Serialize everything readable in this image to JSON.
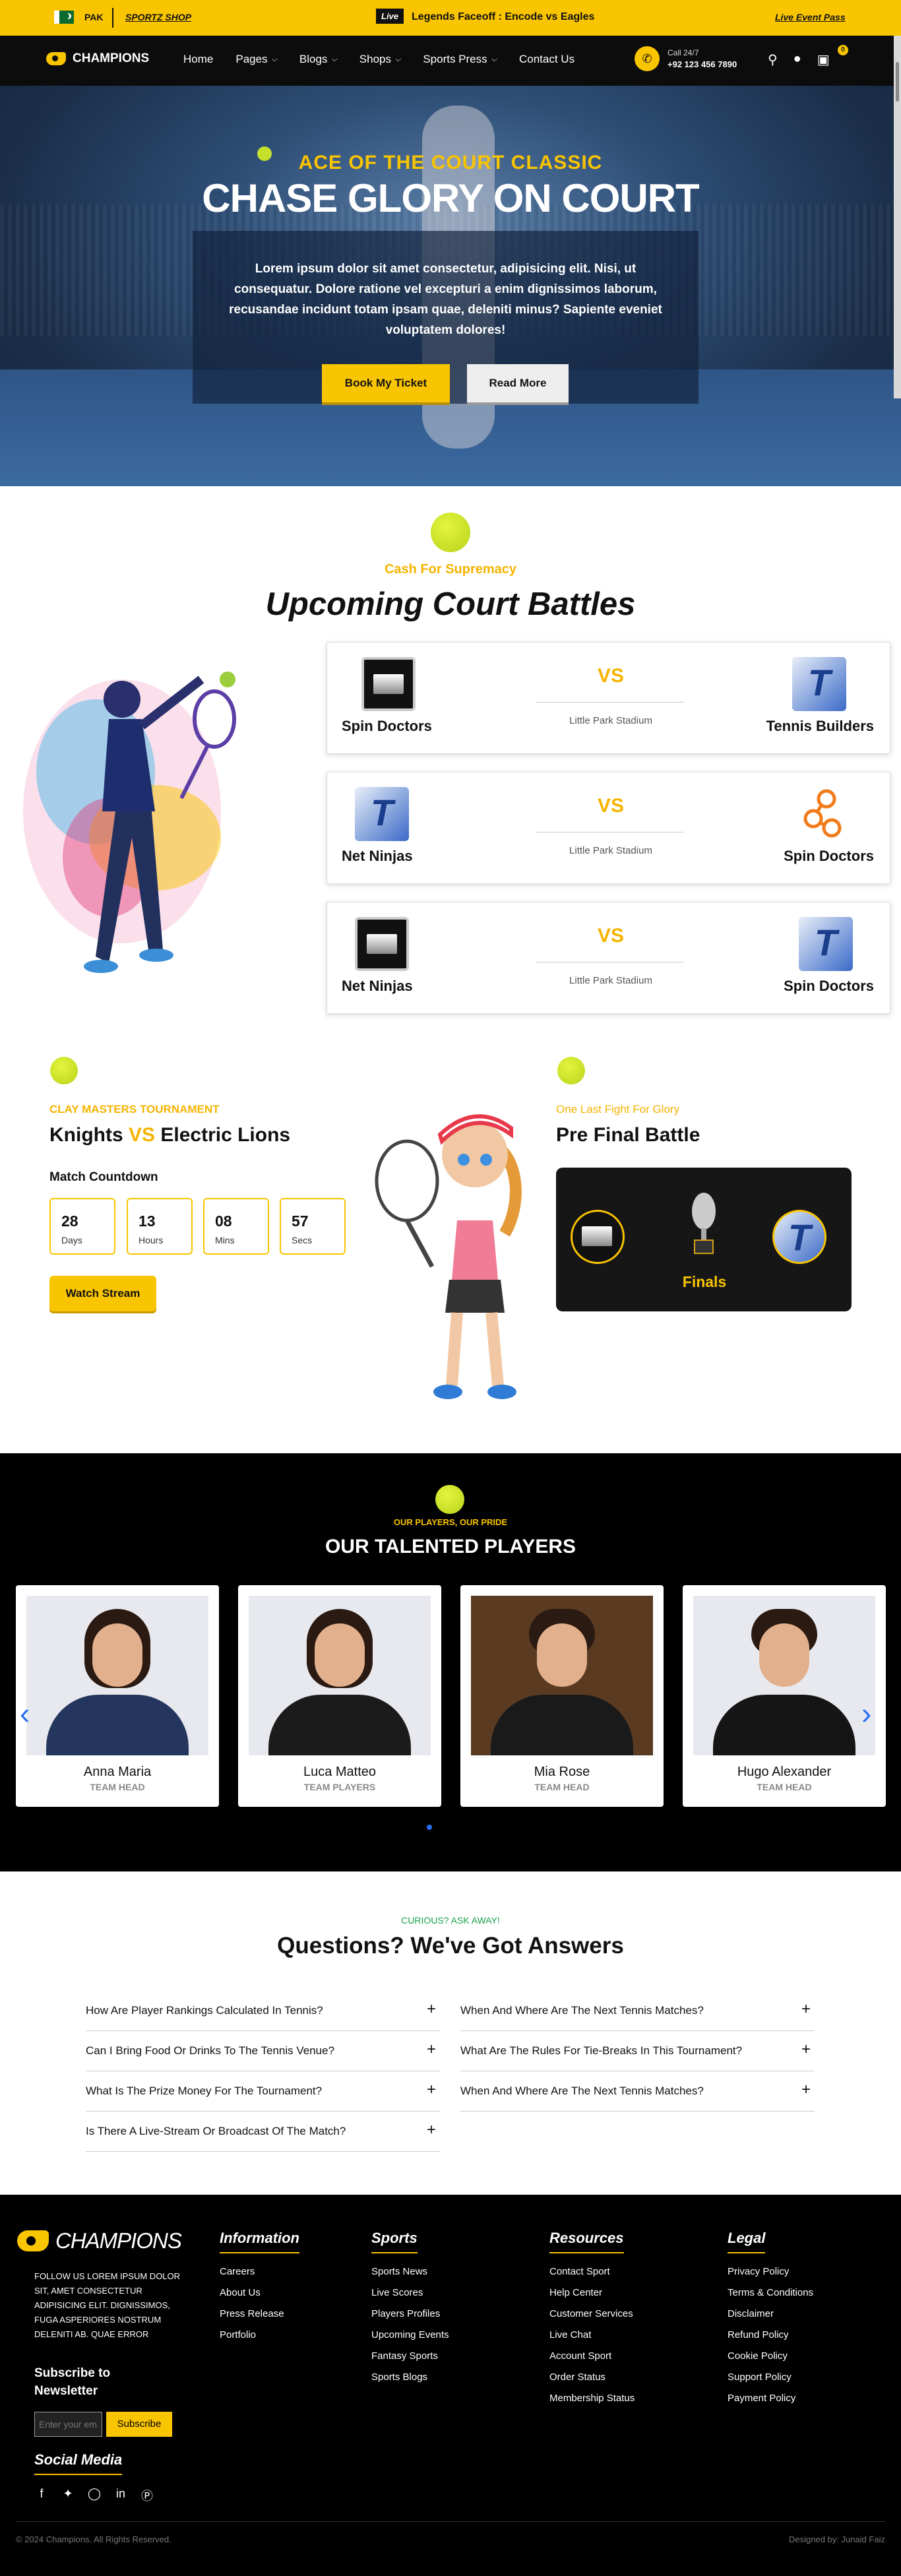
{
  "topbar": {
    "country": "PAK",
    "brand": "SPORTZ SHOP",
    "live": "Live",
    "match": "Legends Faceoff : Encode vs Eagles",
    "pass": "Live Event Pass"
  },
  "nav": {
    "logo": "CHAMPIONS",
    "items": [
      "Home",
      "Pages",
      "Blogs",
      "Shops",
      "Sports Press",
      "Contact Us"
    ],
    "call_label": "Call 24/7",
    "phone": "+92 123 456 7890",
    "cart_count": "0"
  },
  "hero": {
    "kicker": "ACE OF THE COURT CLASSIC",
    "title": "CHASE GLORY ON COURT",
    "text": "Lorem ipsum dolor sit amet consectetur, adipisicing elit. Nisi, ut consequatur. Dolore ratione vel excepturi a enim dignissimos laborum, recusandae incidunt totam ipsam quae, deleniti minus? Sapiente eveniet voluptatem dolores!",
    "btn_primary": "Book My Ticket",
    "btn_secondary": "Read More"
  },
  "battles": {
    "kicker": "Cash For Supremacy",
    "title": "Upcoming Court Battles",
    "matches": [
      {
        "left": "Spin Doctors",
        "right": "Tennis Builders",
        "vs": "VS",
        "stadium": "Little Park Stadium"
      },
      {
        "left": "Net Ninjas",
        "right": "Spin Doctors",
        "vs": "VS",
        "stadium": "Little Park Stadium"
      },
      {
        "left": "Net Ninjas",
        "right": "Spin Doctors",
        "vs": "VS",
        "stadium": "Little Park Stadium"
      }
    ]
  },
  "clay": {
    "kicker": "CLAY MASTERS TOURNAMENT",
    "team1": "Knights",
    "vs": "VS",
    "team2": "Electric Lions",
    "countdown_label": "Match Countdown",
    "countdown": [
      {
        "value": "28",
        "unit": "Days"
      },
      {
        "value": "13",
        "unit": "Hours"
      },
      {
        "value": "08",
        "unit": "Mins"
      },
      {
        "value": "57",
        "unit": "Secs"
      }
    ],
    "btn": "Watch Stream"
  },
  "prefinal": {
    "kicker": "One Last Fight For Glory",
    "title": "Pre Final Battle",
    "finals": "Finals"
  },
  "players": {
    "kicker": "OUR PLAYERS, OUR PRIDE",
    "title": "OUR TALENTED PLAYERS",
    "list": [
      {
        "name": "Anna Maria",
        "role": "TEAM HEAD"
      },
      {
        "name": "Luca Matteo",
        "role": "TEAM PLAYERS"
      },
      {
        "name": "Mia Rose",
        "role": "TEAM HEAD"
      },
      {
        "name": "Hugo Alexander",
        "role": "TEAM HEAD"
      }
    ]
  },
  "faq": {
    "kicker": "CURIOUS? ASK AWAY!",
    "title": "Questions? We've Got Answers",
    "left": [
      "How Are Player Rankings Calculated In Tennis?",
      "Can I Bring Food Or Drinks To The Tennis Venue?",
      "What Is The Prize Money For The Tournament?",
      "Is There A Live-Stream Or Broadcast Of The Match?"
    ],
    "right": [
      "When And Where Are The Next Tennis Matches?",
      "What Are The Rules For Tie-Breaks In This Tournament?",
      "When And Where Are The Next Tennis Matches?"
    ]
  },
  "footer": {
    "logo": "CHAMPIONS",
    "about": "FOLLOW US LOREM IPSUM DOLOR SIT, AMET CONSECTETUR ADIPISICING ELIT. DIGNISSIMOS, FUGA ASPERIORES NOSTRUM DELENITI AB. QUAE ERROR",
    "newsletter_title": "Subscribe to Newsletter",
    "newsletter_placeholder": "Enter your email",
    "subscribe": "Subscribe",
    "social_title": "Social Media",
    "cols": [
      {
        "title": "Information",
        "links": [
          "Careers",
          "About Us",
          "Press Release",
          "Portfolio"
        ]
      },
      {
        "title": "Sports",
        "links": [
          "Sports News",
          "Live Scores",
          "Players Profiles",
          "Upcoming Events",
          "Fantasy Sports",
          "Sports Blogs"
        ]
      },
      {
        "title": "Resources",
        "links": [
          "Contact Sport",
          "Help Center",
          "Customer Services",
          "Live Chat",
          "Account Sport",
          "Order Status",
          "Membership Status"
        ]
      },
      {
        "title": "Legal",
        "links": [
          "Privacy Policy",
          "Terms & Conditions",
          "Disclaimer",
          "Refund Policy",
          "Cookie Policy",
          "Support Policy",
          "Payment Policy"
        ]
      }
    ],
    "copyright": "© 2024 Champions. All Rights Reserved.",
    "designer": "Designed by: Junaid Faiz"
  }
}
